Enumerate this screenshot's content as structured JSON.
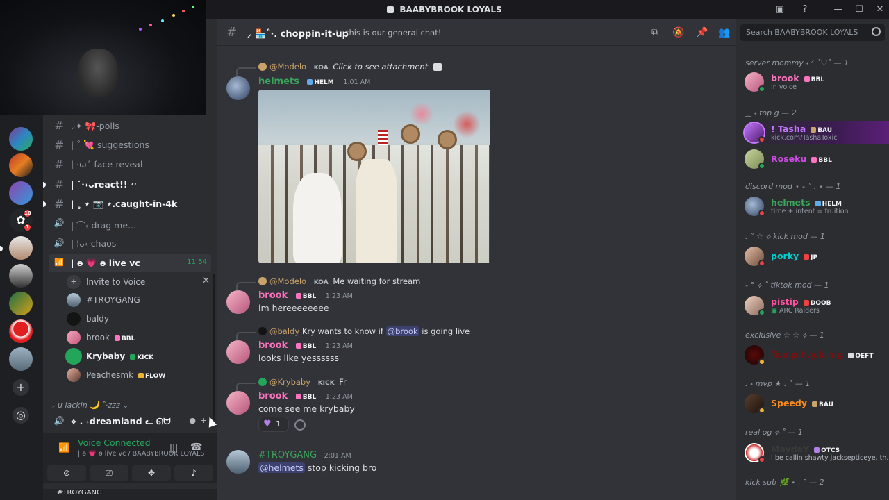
{
  "window": {
    "title": "BAABYBROOK LOYALS",
    "icons": [
      "inbox-icon",
      "help-icon",
      "minimize-icon",
      "maximize-icon",
      "close-icon"
    ]
  },
  "colors": {
    "accent": "#5865f2",
    "online": "#23a55a",
    "dnd": "#f23f43",
    "idle": "#f0b232",
    "pink": "#ff73c0"
  },
  "server_rail": {
    "add_server_icon": "plus-icon",
    "discover_icon": "compass-icon",
    "badges": [
      "10",
      "1"
    ]
  },
  "channels": [
    {
      "sym": "#",
      "name": "⸝✦ 🎀-polls",
      "unread": false
    },
    {
      "sym": "#",
      "name": "| ˚ 💘 suggestions",
      "unread": false
    },
    {
      "sym": "#",
      "name": "| ·ω˚-face-reveal",
      "unread": false
    },
    {
      "sym": "#",
      "name": "| ˙·˖ᴗreact!! ˒˒",
      "unread": true
    },
    {
      "sym": "#",
      "name": "| ˳ ⋆ 📷 ⋆.caught-in-4k",
      "unread": true
    },
    {
      "sym": "🔊",
      "name": "| ⌒˖ drag me...",
      "unread": false
    },
    {
      "sym": "🔊",
      "name": "| ⁞ᴗ˖ chaos",
      "unread": false
    },
    {
      "sym": "📶",
      "name": "| ɵ 💗 ɵ live vc",
      "unread": true
    }
  ],
  "live_vc_timer": "11:54",
  "invite_to_voice": "Invite to Voice",
  "voice_users": [
    {
      "name": "#TROYGANG",
      "tag": "",
      "tag_color": ""
    },
    {
      "name": "baldy",
      "tag": "",
      "tag_color": ""
    },
    {
      "name": "brook",
      "tag": "BBL",
      "tag_color": "#ff73c0"
    },
    {
      "name": "Krybaby",
      "tag": "KICK",
      "tag_color": "#23a55a"
    },
    {
      "name": "Peachesmk",
      "tag": "FLOW",
      "tag_color": "#f0b232"
    }
  ],
  "category_label": "⸝ u lackin 🌙 ˚·zzz",
  "dreamland_channel": "⟡ . ˖dreamland ᓚ ᘏᗢ",
  "voice_panel": {
    "status": "Voice Connected",
    "location": "| ɵ 💗 ɵ live vc / BAABYBROOK LOYALS",
    "buttons": [
      "camera-off-icon",
      "screenshare-icon",
      "activities-icon",
      "soundboard-icon"
    ]
  },
  "user_bar": {
    "name": "#TROYGANG"
  },
  "chat_header": {
    "channel": "⸝ 🏪˚‧. choppin-it-up",
    "topic": "this is our general chat!",
    "icons": [
      "threads-icon",
      "mute-icon",
      "pin-icon",
      "members-icon"
    ]
  },
  "messages": [
    {
      "reply_author": "@Modelo",
      "reply_tag": "KOA",
      "reply_text": "Click to see attachment",
      "author": "helmets",
      "author_color": "#3ba55c",
      "tag": "HELM",
      "time": "1:01 AM",
      "text": ""
    },
    {
      "reply_author": "@Modelo",
      "reply_tag": "KOA",
      "reply_text": "Me waiting for stream",
      "author": "brook",
      "author_color": "#ff73c0",
      "tag": "BBL",
      "time": "1:23 AM",
      "text": "im hereeeeeeee"
    },
    {
      "reply_author": "@baldy",
      "reply_tag": "",
      "reply_text": "Kry wants to know if",
      "reply_mention": "@brook",
      "reply_tail": "is going live",
      "author": "brook",
      "author_color": "#ff73c0",
      "tag": "BBL",
      "time": "1:23 AM",
      "text": "looks like yessssss"
    },
    {
      "reply_author": "@Krybaby",
      "reply_tag": "KICK",
      "reply_text": "Fr",
      "author": "brook",
      "author_color": "#ff73c0",
      "tag": "BBL",
      "time": "1:23 AM",
      "text": "come see  me krybaby"
    },
    {
      "author": "#TROYGANG",
      "author_color": "#3ba55c",
      "time": "2:01 AM",
      "mention": "@helmets",
      "text": "stop kicking bro"
    }
  ],
  "reaction": {
    "emoji": "heart",
    "count": "1"
  },
  "search_placeholder": "Search BAABYBROOK LOYALS",
  "member_groups": [
    {
      "role": "server mommy ˖ ᐟ ˚♡˚ — 1",
      "members": [
        {
          "name": "brook",
          "color": "#ff73c0",
          "tag": "BBL",
          "sub": "In voice",
          "status": "online"
        }
      ]
    },
    {
      "role": "⁔ ˖ top g — 2",
      "members": [
        {
          "name": "! Tasha",
          "color": "#c678ff",
          "tag": "BAU",
          "sub": "kick.com/TashaToxic",
          "status": "dnd"
        },
        {
          "name": "Roseku",
          "color": "#d04ae6",
          "tag": "BBL",
          "sub": "",
          "status": "online"
        }
      ]
    },
    {
      "role": "discord mod ⋆ ˖ ˚ . ⋆ — 1",
      "members": [
        {
          "name": "helmets",
          "color": "#3ba55c",
          "tag": "HELM",
          "sub": "time + intent = fruition",
          "status": "dnd"
        }
      ]
    },
    {
      "role": ". ˚ ☆ ⟡ kick mod — 1",
      "members": [
        {
          "name": "porky",
          "color": "#00d0d0",
          "tag": "JP",
          "sub": "",
          "status": "dnd"
        }
      ]
    },
    {
      "role": "˖ ° ⟡ ˚ tiktok mod — 1",
      "members": [
        {
          "name": "pistip",
          "color": "#ff4fa0",
          "tag": "DOOB",
          "sub": "ARC Raiders",
          "status": "online"
        }
      ]
    },
    {
      "role": "exclusive ☆ ☆ ⟡ — 1",
      "members": [
        {
          "name": "Tr.ø.p.h.y.k.n.g",
          "color": "#7a1010",
          "tag": "OEFT",
          "sub": "",
          "status": "idle"
        }
      ]
    },
    {
      "role": ". ˖ mvp ★ . ˚ — 1",
      "members": [
        {
          "name": "Speedy",
          "color": "#ff8c1a",
          "tag": "BAU",
          "sub": "",
          "status": "idle"
        }
      ]
    },
    {
      "role": "real og ⟡ ˚ — 1",
      "members": [
        {
          "name": "MaydaY",
          "color": "#3a3a3a",
          "tag": "OTCS",
          "sub": "I be callin shawty jacksepticeye, th...",
          "status": "dnd"
        }
      ]
    },
    {
      "role": "kick sub 🌿 ⋆ . ° — 2",
      "members": []
    }
  ]
}
